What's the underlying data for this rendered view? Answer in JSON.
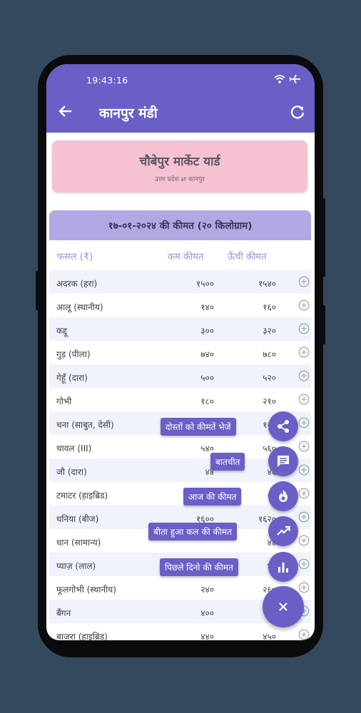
{
  "status": {
    "time": "19:43:16"
  },
  "header": {
    "title": "कानपुर मंडी"
  },
  "yard": {
    "name": "चौबेपुर मार्केट यार्ड",
    "location": "उत्तर प्रदेश ⇄ कानपुर"
  },
  "price_table": {
    "title": "१७-०१-२०२४ की कीमत (२० किलोग्राम)",
    "columns": {
      "crop": "फसल (₹)",
      "min": "कम कीमत",
      "max": "ऊँची कीमत"
    },
    "rows": [
      {
        "crop": "अदरक (हरा)",
        "min": "१५००",
        "max": "१५४०"
      },
      {
        "crop": "आलू (स्थानीय)",
        "min": "१४०",
        "max": "१६०"
      },
      {
        "crop": "कद्दू",
        "min": "३००",
        "max": "३२०"
      },
      {
        "crop": "गुड़ (पीला)",
        "min": "७४०",
        "max": "७८०"
      },
      {
        "crop": "गेहूँ (दारा)",
        "min": "५००",
        "max": "५२०"
      },
      {
        "crop": "गोभी",
        "min": "१८०",
        "max": "२१०"
      },
      {
        "crop": "चना (साबुत, देसी)",
        "min": "",
        "max": "१२०"
      },
      {
        "crop": "चावल (III)",
        "min": "५४०",
        "max": "५६०"
      },
      {
        "crop": "जौ (दारा)",
        "min": "४४",
        "max": "४६"
      },
      {
        "crop": "टमाटर (हाइब्रिड)",
        "min": "",
        "max": "२४"
      },
      {
        "crop": "धनिया (बीज)",
        "min": "१६००",
        "max": "१६२०"
      },
      {
        "crop": "धान (सामान्य)",
        "min": "",
        "max": "४४"
      },
      {
        "crop": "प्याज़ (लाल)",
        "min": "",
        "max": "४२"
      },
      {
        "crop": "फूलगोभी (स्थानीय)",
        "min": "२४०",
        "max": "२६०"
      },
      {
        "crop": "बैंगन",
        "min": "४००",
        "max": "४"
      },
      {
        "crop": "बाजरा (हाइब्रिड)",
        "min": "४४०",
        "max": "४५०"
      }
    ]
  },
  "fab_menu": {
    "share": "दोस्तों को कीमतें भेजें",
    "chat": "बातचीत",
    "today": "आज की कीमत",
    "yesterday": "बीता हुआ कल की कीमत",
    "previous": "पिछले दिनो की कीमत"
  },
  "colors": {
    "primary": "#6a5fc7",
    "card": "#f6c2d2",
    "table_header": "#b3a7e4",
    "background": "#34495e"
  },
  "icons": [
    "back-arrow-icon",
    "refresh-icon",
    "wifi-icon",
    "airplane-icon",
    "plus-circle-icon",
    "share-icon",
    "chat-icon",
    "fire-icon",
    "trending-up-icon",
    "bar-chart-icon",
    "close-icon"
  ]
}
